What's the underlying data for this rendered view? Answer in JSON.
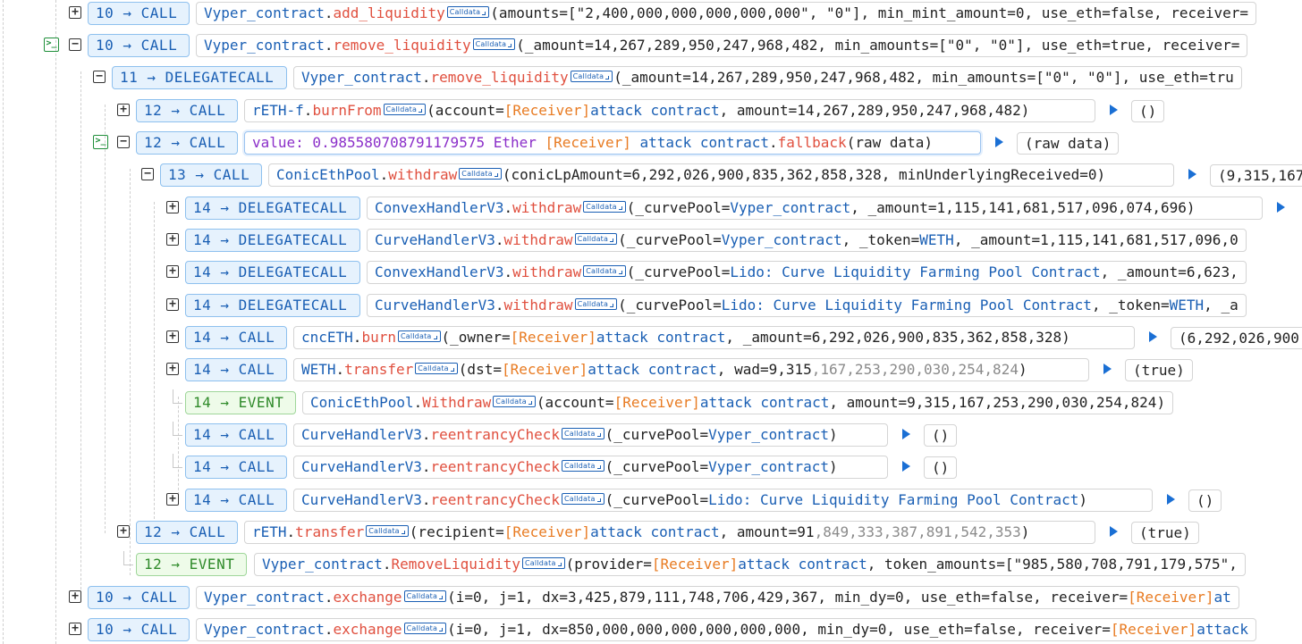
{
  "calldata_label": "Calldata",
  "rows": [
    {
      "depth": "10",
      "kind": "CALL",
      "contract": "Vyper_contract",
      "method": "add_liquidity",
      "calldata": true,
      "args": [
        [
          "plain",
          "(amounts=[\"2,400,000,000,000,000,000\", \"0\"], min_mint_amount=0, use_eth=false, receiver="
        ]
      ]
    },
    {
      "depth": "10",
      "kind": "CALL",
      "contract": "Vyper_contract",
      "method": "remove_liquidity",
      "calldata": true,
      "args": [
        [
          "plain",
          "(_amount=14,267,289,950,247,968,482, min_amounts=[\"0\", \"0\"], use_eth=true, receiver="
        ]
      ]
    },
    {
      "depth": "11",
      "kind": "DELEGATECALL",
      "contract": "Vyper_contract",
      "method": "remove_liquidity",
      "calldata": true,
      "args": [
        [
          "plain",
          "(_amount=14,267,289,950,247,968,482, min_amounts=[\"0\", \"0\"], use_eth=tru"
        ]
      ]
    },
    {
      "depth": "12",
      "kind": "CALL",
      "contract": "rETH-f",
      "method": "burnFrom",
      "calldata": true,
      "args": [
        [
          "plain",
          "(account="
        ],
        [
          "recv",
          "[Receiver]"
        ],
        [
          "addr",
          "attack contract"
        ],
        [
          "plain",
          ", amount=14,267,289,950,247,968,482)"
        ]
      ],
      "ret": "()"
    },
    {
      "depth": "12",
      "kind": "CALL",
      "value_label": "value: 0.985580708791179575 Ether",
      "value_recv": "[Receiver]",
      "value_addr": "attack contract",
      "method": "fallback",
      "args": [
        [
          "plain",
          "(raw data)"
        ]
      ],
      "ret": "(raw data)"
    },
    {
      "depth": "13",
      "kind": "CALL",
      "contract": "ConicEthPool",
      "method": "withdraw",
      "calldata": true,
      "args": [
        [
          "plain",
          "(conicLpAmount=6,292,026,900,835,362,858,328, minUnderlyingReceived=0)"
        ]
      ],
      "ret": "(9,315,167"
    },
    {
      "depth": "14",
      "kind": "DELEGATECALL",
      "contract": "ConvexHandlerV3",
      "method": "withdraw",
      "calldata": true,
      "args": [
        [
          "plain",
          "(_curvePool="
        ],
        [
          "addr",
          "Vyper_contract"
        ],
        [
          "plain",
          ", _amount=1,115,141,681,517,096,074,696)"
        ]
      ],
      "ret": ""
    },
    {
      "depth": "14",
      "kind": "DELEGATECALL",
      "contract": "CurveHandlerV3",
      "method": "withdraw",
      "calldata": true,
      "args": [
        [
          "plain",
          "(_curvePool="
        ],
        [
          "addr",
          "Vyper_contract"
        ],
        [
          "plain",
          ", _token="
        ],
        [
          "addr",
          "WETH"
        ],
        [
          "plain",
          ", _amount=1,115,141,681,517,096,0"
        ]
      ]
    },
    {
      "depth": "14",
      "kind": "DELEGATECALL",
      "contract": "ConvexHandlerV3",
      "method": "withdraw",
      "calldata": true,
      "args": [
        [
          "plain",
          "(_curvePool="
        ],
        [
          "addr",
          "Lido: Curve Liquidity Farming Pool Contract"
        ],
        [
          "plain",
          ", _amount=6,623,"
        ]
      ]
    },
    {
      "depth": "14",
      "kind": "DELEGATECALL",
      "contract": "CurveHandlerV3",
      "method": "withdraw",
      "calldata": true,
      "args": [
        [
          "plain",
          "(_curvePool="
        ],
        [
          "addr",
          "Lido: Curve Liquidity Farming Pool Contract"
        ],
        [
          "plain",
          ", _token="
        ],
        [
          "addr",
          "WETH"
        ],
        [
          "plain",
          ", _a"
        ]
      ]
    },
    {
      "depth": "14",
      "kind": "CALL",
      "contract": "cncETH",
      "method": "burn",
      "calldata": true,
      "args": [
        [
          "plain",
          "(_owner="
        ],
        [
          "recv",
          "[Receiver]"
        ],
        [
          "addr",
          "attack contract"
        ],
        [
          "plain",
          ", _amount=6,292,026,900,835,362,858,328)"
        ]
      ],
      "ret": "(6,292,026,900"
    },
    {
      "depth": "14",
      "kind": "CALL",
      "contract": "WETH",
      "method": "transfer",
      "calldata": true,
      "args": [
        [
          "plain",
          "(dst="
        ],
        [
          "recv",
          "[Receiver]"
        ],
        [
          "addr",
          "attack contract"
        ],
        [
          "plain",
          ", wad=9,315"
        ],
        [
          "grey",
          ",167,253,290,030,254,824"
        ],
        [
          "plain",
          ")"
        ]
      ],
      "ret": "(true)"
    },
    {
      "depth": "14",
      "kind": "EVENT",
      "contract": "ConicEthPool",
      "method": "Withdraw",
      "calldata": true,
      "args": [
        [
          "plain",
          "(account="
        ],
        [
          "recv",
          "[Receiver]"
        ],
        [
          "addr",
          "attack contract"
        ],
        [
          "plain",
          ", amount=9,315,167,253,290,030,254,824)"
        ]
      ]
    },
    {
      "depth": "14",
      "kind": "CALL",
      "contract": "CurveHandlerV3",
      "method": "reentrancyCheck",
      "calldata": true,
      "args": [
        [
          "plain",
          "(_curvePool="
        ],
        [
          "addr",
          "Vyper_contract"
        ],
        [
          "plain",
          ")"
        ]
      ],
      "ret": "()"
    },
    {
      "depth": "14",
      "kind": "CALL",
      "contract": "CurveHandlerV3",
      "method": "reentrancyCheck",
      "calldata": true,
      "args": [
        [
          "plain",
          "(_curvePool="
        ],
        [
          "addr",
          "Vyper_contract"
        ],
        [
          "plain",
          ")"
        ]
      ],
      "ret": "()"
    },
    {
      "depth": "14",
      "kind": "CALL",
      "contract": "CurveHandlerV3",
      "method": "reentrancyCheck",
      "calldata": true,
      "args": [
        [
          "plain",
          "(_curvePool="
        ],
        [
          "addr",
          "Lido: Curve Liquidity Farming Pool Contract"
        ],
        [
          "plain",
          ")"
        ]
      ],
      "ret": "()"
    },
    {
      "depth": "12",
      "kind": "CALL",
      "contract": "rETH",
      "method": "transfer",
      "calldata": true,
      "args": [
        [
          "plain",
          "(recipient="
        ],
        [
          "recv",
          "[Receiver]"
        ],
        [
          "addr",
          "attack contract"
        ],
        [
          "plain",
          ", amount=91"
        ],
        [
          "grey",
          ",849,333,387,891,542,353"
        ],
        [
          "plain",
          ")"
        ]
      ],
      "ret": "(true)"
    },
    {
      "depth": "12",
      "kind": "EVENT",
      "contract": "Vyper_contract",
      "method": "RemoveLiquidity",
      "calldata": true,
      "args": [
        [
          "plain",
          "(provider="
        ],
        [
          "recv",
          "[Receiver]"
        ],
        [
          "addr",
          "attack contract"
        ],
        [
          "plain",
          ", token_amounts=[\"985,580,708,791,179,575\","
        ]
      ]
    },
    {
      "depth": "10",
      "kind": "CALL",
      "contract": "Vyper_contract",
      "method": "exchange",
      "calldata": true,
      "args": [
        [
          "plain",
          "(i=0, j=1, dx=3,425,879,111,748,706,429,367, min_dy=0, use_eth=false, receiver="
        ],
        [
          "recv",
          "[Receiver]"
        ],
        [
          "addr",
          "at"
        ]
      ]
    },
    {
      "depth": "10",
      "kind": "CALL",
      "contract": "Vyper_contract",
      "method": "exchange",
      "calldata": true,
      "args": [
        [
          "plain",
          "(i=0, j=1, dx=850,000,000,000,000,000,000, min_dy=0, use_eth=false, receiver="
        ],
        [
          "recv",
          "[Receiver]"
        ],
        [
          "addr",
          "attack"
        ]
      ]
    }
  ],
  "colors": {
    "call_badge_bg": "#e6f2fd",
    "event_badge_bg": "#eefbe9",
    "contract": "#1a5fb4",
    "method": "#e0503f",
    "receiver": "#e87b22",
    "value": "#8b2fc9"
  }
}
